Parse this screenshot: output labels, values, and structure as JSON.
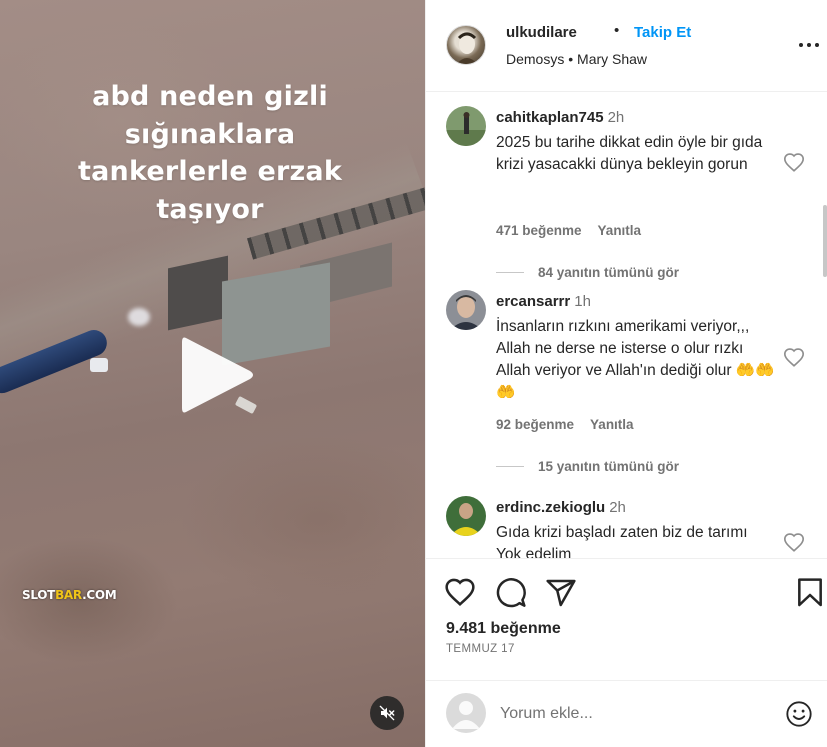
{
  "video": {
    "caption_lines": [
      "abd neden gizli",
      "sığınaklara",
      "tankerlerle erzak",
      "taşıyor"
    ],
    "watermark": "SLOTBAR.COM",
    "watermark_accent_part": "BAR"
  },
  "post": {
    "username": "ulkudilare",
    "separator": "•",
    "follow_label": "Takip Et",
    "audio": "Demosys • Mary Shaw"
  },
  "comments": [
    {
      "username": "cahitkaplan745",
      "time": "2h",
      "text": "2025 bu tarihe dikkat edin öyle bir gıda krizi yasacakki dünya bekleyin gorun",
      "likes": "471 beğenme",
      "reply_label": "Yanıtla",
      "view_replies": "84 yanıtın tümünü gör"
    },
    {
      "username": "ercansarrr",
      "time": "1h",
      "text": "İnsanların rızkını amerikami veriyor,,, Allah ne derse ne isterse o olur rızkı Allah veriyor ve Allah'ın dediği olur 🤲🤲🤲",
      "likes": "92 beğenme",
      "reply_label": "Yanıtla",
      "view_replies": "15 yanıtın tümünü gör"
    },
    {
      "username": "erdinc.zekioglu",
      "time": "2h",
      "text": "Gıda krizi başladı zaten biz de tarımı Yok edelim"
    }
  ],
  "actions": {
    "like_count": "9.481 beğenme",
    "date": "TEMMUZ 17"
  },
  "add_comment": {
    "placeholder": "Yorum ekle..."
  },
  "colors": {
    "accent": "#0095f6",
    "text": "#262626",
    "muted": "#737373",
    "border": "#efefef"
  },
  "icons": [
    "play-icon",
    "mute-icon",
    "more-icon",
    "heart-icon",
    "comment-icon",
    "share-icon",
    "bookmark-icon",
    "emoji-icon"
  ]
}
